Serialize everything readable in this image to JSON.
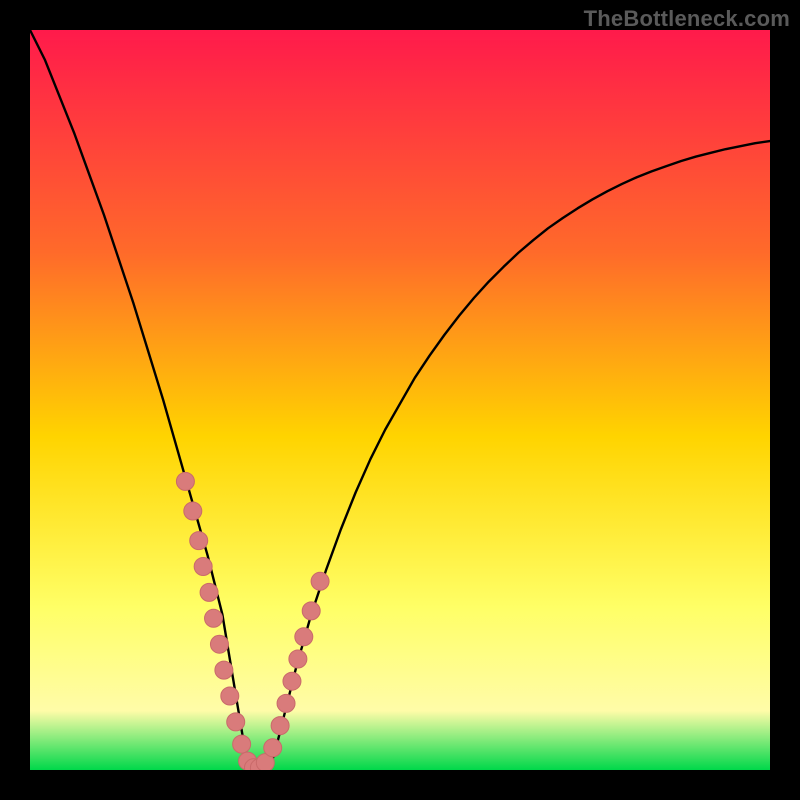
{
  "watermark": "TheBottleneck.com",
  "colors": {
    "frame": "#000000",
    "gradient_top": "#ff1a4b",
    "gradient_mid1": "#ff6a2a",
    "gradient_mid2": "#ffd400",
    "gradient_mid3": "#ffff66",
    "gradient_mid4": "#fffca8",
    "gradient_bottom": "#00d84a",
    "curve": "#000000",
    "marker_fill": "#d97b7b",
    "marker_stroke": "#c96a6a"
  },
  "chart_data": {
    "type": "line",
    "title": "",
    "xlabel": "",
    "ylabel": "",
    "xlim": [
      0,
      100
    ],
    "ylim": [
      0,
      100
    ],
    "curve": {
      "x": [
        0,
        2,
        4,
        6,
        8,
        10,
        12,
        14,
        16,
        18,
        20,
        22,
        24,
        26,
        26.5,
        27,
        27.5,
        28,
        28.5,
        29,
        30,
        31,
        32,
        33,
        34,
        35,
        36,
        38,
        40,
        42,
        44,
        46,
        48,
        50,
        52,
        54,
        56,
        58,
        60,
        62,
        64,
        66,
        68,
        70,
        72,
        74,
        76,
        78,
        80,
        82,
        84,
        86,
        88,
        90,
        92,
        94,
        96,
        98,
        100
      ],
      "y": [
        100,
        96,
        91,
        86,
        80.5,
        75,
        69,
        63,
        56.5,
        50,
        43,
        36,
        29,
        21,
        18,
        15,
        12,
        9,
        6,
        3,
        0,
        0,
        0,
        2,
        6,
        10,
        14,
        21,
        27,
        32.5,
        37.5,
        42,
        46,
        49.5,
        53,
        56,
        58.8,
        61.4,
        63.8,
        66,
        68,
        69.9,
        71.6,
        73.2,
        74.6,
        75.9,
        77.1,
        78.2,
        79.2,
        80.1,
        80.9,
        81.6,
        82.3,
        82.9,
        83.4,
        83.9,
        84.3,
        84.7,
        85
      ]
    },
    "series": [
      {
        "name": "markers",
        "x": [
          21.0,
          22.0,
          22.8,
          23.4,
          24.2,
          24.8,
          25.6,
          26.2,
          27.0,
          27.8,
          28.6,
          29.4,
          30.2,
          31.0,
          31.8,
          32.8,
          33.8,
          34.6,
          35.4,
          36.2,
          37.0,
          38.0,
          39.2
        ],
        "y": [
          39.0,
          35.0,
          31.0,
          27.5,
          24.0,
          20.5,
          17.0,
          13.5,
          10.0,
          6.5,
          3.5,
          1.2,
          0.3,
          0.3,
          1.0,
          3.0,
          6.0,
          9.0,
          12.0,
          15.0,
          18.0,
          21.5,
          25.5
        ]
      }
    ]
  }
}
